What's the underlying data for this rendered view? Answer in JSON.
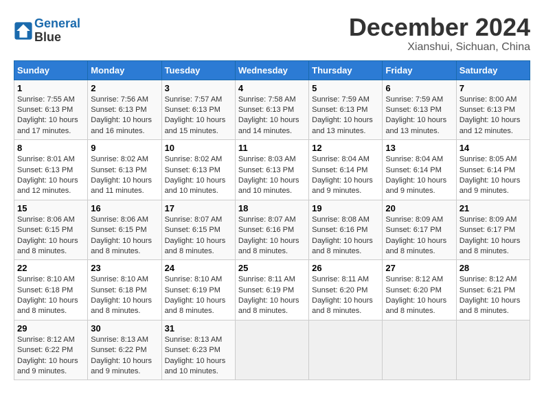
{
  "logo": {
    "line1": "General",
    "line2": "Blue"
  },
  "title": "December 2024",
  "subtitle": "Xianshui, Sichuan, China",
  "days_of_week": [
    "Sunday",
    "Monday",
    "Tuesday",
    "Wednesday",
    "Thursday",
    "Friday",
    "Saturday"
  ],
  "weeks": [
    [
      {
        "day": "1",
        "sunrise": "7:55 AM",
        "sunset": "6:13 PM",
        "daylight": "10 hours and 17 minutes."
      },
      {
        "day": "2",
        "sunrise": "7:56 AM",
        "sunset": "6:13 PM",
        "daylight": "10 hours and 16 minutes."
      },
      {
        "day": "3",
        "sunrise": "7:57 AM",
        "sunset": "6:13 PM",
        "daylight": "10 hours and 15 minutes."
      },
      {
        "day": "4",
        "sunrise": "7:58 AM",
        "sunset": "6:13 PM",
        "daylight": "10 hours and 14 minutes."
      },
      {
        "day": "5",
        "sunrise": "7:59 AM",
        "sunset": "6:13 PM",
        "daylight": "10 hours and 13 minutes."
      },
      {
        "day": "6",
        "sunrise": "7:59 AM",
        "sunset": "6:13 PM",
        "daylight": "10 hours and 13 minutes."
      },
      {
        "day": "7",
        "sunrise": "8:00 AM",
        "sunset": "6:13 PM",
        "daylight": "10 hours and 12 minutes."
      }
    ],
    [
      {
        "day": "8",
        "sunrise": "8:01 AM",
        "sunset": "6:13 PM",
        "daylight": "10 hours and 12 minutes."
      },
      {
        "day": "9",
        "sunrise": "8:02 AM",
        "sunset": "6:13 PM",
        "daylight": "10 hours and 11 minutes."
      },
      {
        "day": "10",
        "sunrise": "8:02 AM",
        "sunset": "6:13 PM",
        "daylight": "10 hours and 10 minutes."
      },
      {
        "day": "11",
        "sunrise": "8:03 AM",
        "sunset": "6:13 PM",
        "daylight": "10 hours and 10 minutes."
      },
      {
        "day": "12",
        "sunrise": "8:04 AM",
        "sunset": "6:14 PM",
        "daylight": "10 hours and 9 minutes."
      },
      {
        "day": "13",
        "sunrise": "8:04 AM",
        "sunset": "6:14 PM",
        "daylight": "10 hours and 9 minutes."
      },
      {
        "day": "14",
        "sunrise": "8:05 AM",
        "sunset": "6:14 PM",
        "daylight": "10 hours and 9 minutes."
      }
    ],
    [
      {
        "day": "15",
        "sunrise": "8:06 AM",
        "sunset": "6:15 PM",
        "daylight": "10 hours and 8 minutes."
      },
      {
        "day": "16",
        "sunrise": "8:06 AM",
        "sunset": "6:15 PM",
        "daylight": "10 hours and 8 minutes."
      },
      {
        "day": "17",
        "sunrise": "8:07 AM",
        "sunset": "6:15 PM",
        "daylight": "10 hours and 8 minutes."
      },
      {
        "day": "18",
        "sunrise": "8:07 AM",
        "sunset": "6:16 PM",
        "daylight": "10 hours and 8 minutes."
      },
      {
        "day": "19",
        "sunrise": "8:08 AM",
        "sunset": "6:16 PM",
        "daylight": "10 hours and 8 minutes."
      },
      {
        "day": "20",
        "sunrise": "8:09 AM",
        "sunset": "6:17 PM",
        "daylight": "10 hours and 8 minutes."
      },
      {
        "day": "21",
        "sunrise": "8:09 AM",
        "sunset": "6:17 PM",
        "daylight": "10 hours and 8 minutes."
      }
    ],
    [
      {
        "day": "22",
        "sunrise": "8:10 AM",
        "sunset": "6:18 PM",
        "daylight": "10 hours and 8 minutes."
      },
      {
        "day": "23",
        "sunrise": "8:10 AM",
        "sunset": "6:18 PM",
        "daylight": "10 hours and 8 minutes."
      },
      {
        "day": "24",
        "sunrise": "8:10 AM",
        "sunset": "6:19 PM",
        "daylight": "10 hours and 8 minutes."
      },
      {
        "day": "25",
        "sunrise": "8:11 AM",
        "sunset": "6:19 PM",
        "daylight": "10 hours and 8 minutes."
      },
      {
        "day": "26",
        "sunrise": "8:11 AM",
        "sunset": "6:20 PM",
        "daylight": "10 hours and 8 minutes."
      },
      {
        "day": "27",
        "sunrise": "8:12 AM",
        "sunset": "6:20 PM",
        "daylight": "10 hours and 8 minutes."
      },
      {
        "day": "28",
        "sunrise": "8:12 AM",
        "sunset": "6:21 PM",
        "daylight": "10 hours and 8 minutes."
      }
    ],
    [
      {
        "day": "29",
        "sunrise": "8:12 AM",
        "sunset": "6:22 PM",
        "daylight": "10 hours and 9 minutes."
      },
      {
        "day": "30",
        "sunrise": "8:13 AM",
        "sunset": "6:22 PM",
        "daylight": "10 hours and 9 minutes."
      },
      {
        "day": "31",
        "sunrise": "8:13 AM",
        "sunset": "6:23 PM",
        "daylight": "10 hours and 10 minutes."
      },
      null,
      null,
      null,
      null
    ]
  ]
}
